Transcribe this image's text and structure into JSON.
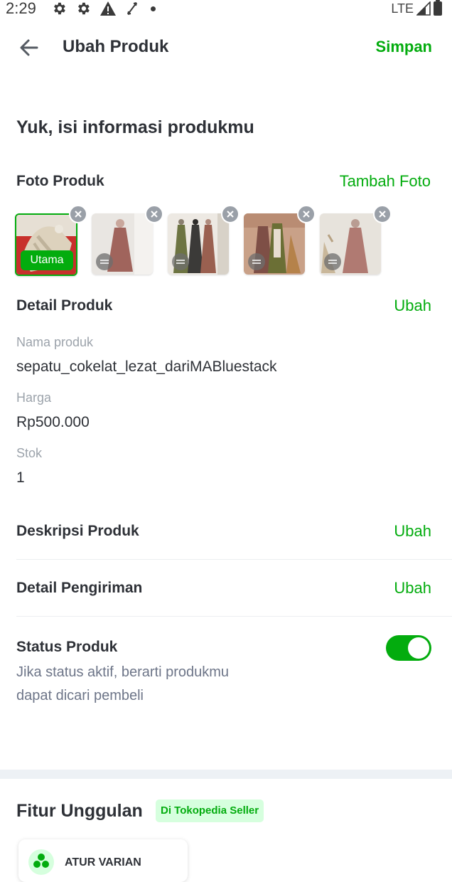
{
  "status_bar": {
    "time": "2:29",
    "network": "LTE",
    "icons": [
      "gear-icon",
      "gear-icon",
      "warning-icon",
      "sync-icon",
      "dot-icon",
      "signal-icon",
      "battery-icon"
    ]
  },
  "header": {
    "title": "Ubah Produk",
    "save_label": "Simpan"
  },
  "intro": {
    "heading": "Yuk, isi informasi produkmu"
  },
  "photos": {
    "title": "Foto Produk",
    "add_label": "Tambah Foto",
    "main_label": "Utama",
    "items": [
      {
        "name": "shoe",
        "main": true
      },
      {
        "name": "dress-mauve",
        "main": false
      },
      {
        "name": "dress-group",
        "main": false
      },
      {
        "name": "dress-olive",
        "main": false
      },
      {
        "name": "dress-pink",
        "main": false
      }
    ]
  },
  "detail": {
    "title": "Detail Produk",
    "edit_label": "Ubah",
    "name_label": "Nama produk",
    "name_value": "sepatu_cokelat_lezat_dariMABluestack",
    "price_label": "Harga",
    "price_value": "Rp500.000",
    "stock_label": "Stok",
    "stock_value": "1"
  },
  "description": {
    "title": "Deskripsi Produk",
    "edit_label": "Ubah"
  },
  "shipping": {
    "title": "Detail Pengiriman",
    "edit_label": "Ubah"
  },
  "status": {
    "title": "Status Produk",
    "desc_line1": "Jika status aktif, berarti produkmu",
    "desc_line2": "dapat dicari pembeli",
    "active": true
  },
  "features": {
    "title": "Fitur Unggulan",
    "badge": "Di Tokopedia Seller",
    "card_label": "ATUR VARIAN"
  },
  "colors": {
    "accent": "#03ac0e",
    "text": "#2e3137",
    "muted": "#9ca3ab"
  }
}
